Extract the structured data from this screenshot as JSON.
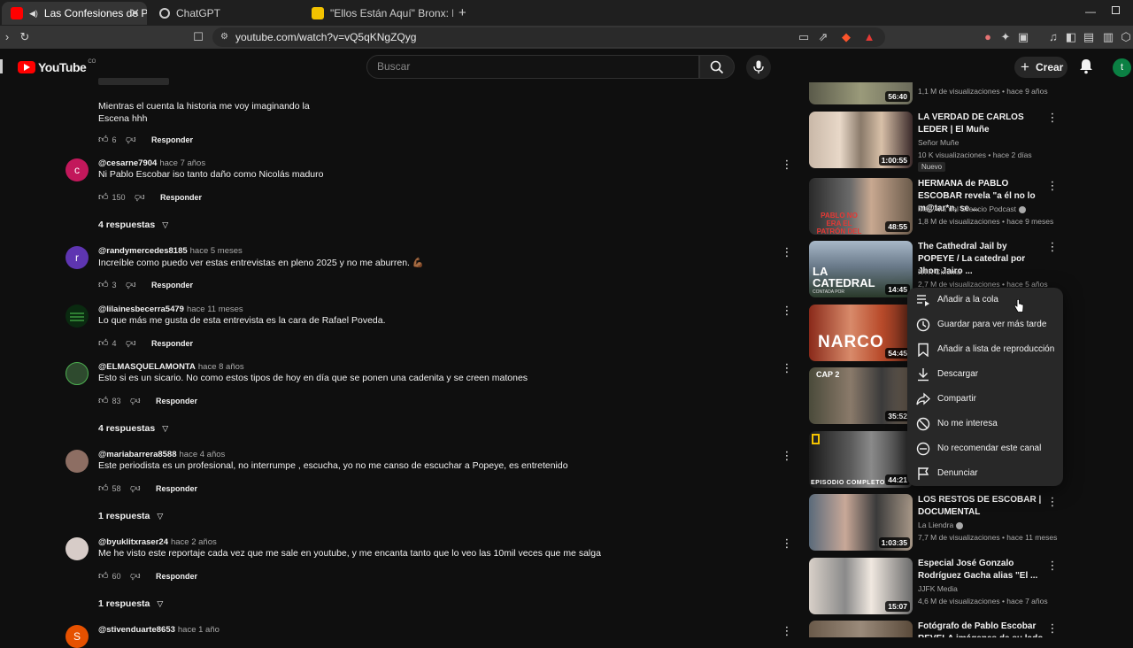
{
  "browser": {
    "tabs": [
      {
        "label": "Las Confesiones de Popeye -",
        "active": true
      },
      {
        "label": "ChatGPT",
        "active": false
      },
      {
        "label": "\"Ellos Están Aquí\" Bronx: La Puerta al",
        "active": false
      }
    ],
    "new_tab": "+",
    "url": "youtube.com/watch?v=vQ5qKNgZQyg"
  },
  "youtube": {
    "logo": "YouTube",
    "country": "CO",
    "search_placeholder": "Buscar",
    "create_label": "Crear",
    "user_initial": "t"
  },
  "comments": [
    {
      "text_lines": [
        "Mientras el   cuenta la historia  me voy imaginando la",
        "Escena hhh"
      ],
      "likes": "6",
      "reply_label": "Responder"
    },
    {
      "user": "@cesarne7904",
      "time": "hace 7 años",
      "text": "Ni Pablo Escobar iso tanto daño como Nicolás maduro",
      "likes": "150",
      "reply_label": "Responder",
      "avatar": "c",
      "avatar_color": "#c2185b",
      "replies": "4 respuestas"
    },
    {
      "user": "@randymercedes8185",
      "time": "hace 5 meses",
      "text": "Increíble como puedo ver estas entrevistas en pleno 2025 y no me aburren. 💪🏾",
      "likes": "3",
      "reply_label": "Responder",
      "avatar": "r",
      "avatar_color": "#5e35b1"
    },
    {
      "user": "@lilainesbecerra5479",
      "time": "hace 11 meses",
      "text": "Lo que más me gusta de esta entrevista es la cara de Rafael Poveda.",
      "likes": "4",
      "reply_label": "Responder",
      "avatar": "",
      "avatar_color": "#1b5e20"
    },
    {
      "user": "@ELMASQUELAMONTA",
      "time": "hace 8 años",
      "text": "Esto si es un sicario. No como estos tipos de hoy en día que se ponen una cadenita y se creen matones",
      "likes": "83",
      "reply_label": "Responder",
      "avatar": "",
      "avatar_color": "#2e7d32",
      "replies": "4 respuestas"
    },
    {
      "user": "@mariabarrera8588",
      "time": "hace 4 años",
      "text": "Este periodista es un profesional, no interrumpe , escucha, yo no me canso de escuchar a Popeye, es entretenido",
      "likes": "58",
      "reply_label": "Responder",
      "avatar": "",
      "avatar_color": "#8d6e63",
      "replies": "1 respuesta"
    },
    {
      "user": "@byuklitxraser24",
      "time": "hace 2 años",
      "text": "Me he visto este reportaje cada vez que me sale en youtube, y me encanta tanto que lo veo las 10mil veces que me salga",
      "likes": "60",
      "reply_label": "Responder",
      "avatar": "",
      "avatar_color": "#bcaaa4",
      "replies": "1 respuesta"
    },
    {
      "user": "@stivenduarte8653",
      "time": "hace 1 año",
      "avatar": "S",
      "avatar_color": "#e65100"
    }
  ],
  "sidebar": [
    {
      "duration": "56:40",
      "stats": "1,1 M de visualizaciones • hace 9 años"
    },
    {
      "title": "LA VERDAD DE CARLOS LEDER | El Muñe",
      "channel": "Señor Muñe",
      "stats": "10 K visualizaciones • hace 2 días",
      "badge": "Nuevo",
      "duration": "1:00:55"
    },
    {
      "title": "HERMANA de PABLO ESCOBAR revela \"a él no lo m@tar*n, se ...",
      "channel": "Más Allá del Silencio Podcast",
      "stats": "1,8 M de visualizaciones • hace 9 meses",
      "duration": "48:55",
      "thumb_text": "PABLO NO ERA EL PATRÓN DEL MAL"
    },
    {
      "title": "The Cathedral Jail by POPEYE / La catedral por Jhon Jairo ...",
      "channel": "NTK Cinema",
      "stats": "2,7 M de visualizaciones • hace 5 años",
      "duration": "14:45",
      "thumb_text": "LA CATEDRAL",
      "thumb_sub": "CONTADA POR"
    },
    {
      "duration": "54:45",
      "thumb_text": "NARCO"
    },
    {
      "duration": "35:52",
      "thumb_text": "CAP 2"
    },
    {
      "duration": "44:21",
      "thumb_text": "EPISODIO COMPLETO"
    },
    {
      "title": "LOS RESTOS DE ESCOBAR | DOCUMENTAL",
      "channel": "La Liendra",
      "stats": "7,7 M de visualizaciones • hace 11 meses",
      "duration": "1:03:35"
    },
    {
      "title": "Especial José Gonzalo Rodríguez Gacha alias \"El ...",
      "channel": "JJFK Media",
      "stats": "4,6 M de visualizaciones • hace 7 años",
      "duration": "15:07"
    },
    {
      "title": "Fotógrafo de Pablo Escobar REVELA imágenes de su lado ..."
    }
  ],
  "context_menu": {
    "items": [
      {
        "label": "Añadir a la cola",
        "icon": "queue-icon"
      },
      {
        "label": "Guardar para ver más tarde",
        "icon": "clock-icon"
      },
      {
        "label": "Añadir a lista de reproducción",
        "icon": "bookmark-icon"
      },
      {
        "label": "Descargar",
        "icon": "download-icon"
      },
      {
        "label": "Compartir",
        "icon": "share-icon"
      },
      {
        "label": "No me interesa",
        "icon": "block-icon"
      },
      {
        "label": "No recomendar este canal",
        "icon": "minus-circle-icon"
      },
      {
        "label": "Denunciar",
        "icon": "flag-icon"
      }
    ]
  },
  "colors": {
    "brand": "#ff0000",
    "bg": "#0f0f0f",
    "menu_bg": "#282828"
  }
}
